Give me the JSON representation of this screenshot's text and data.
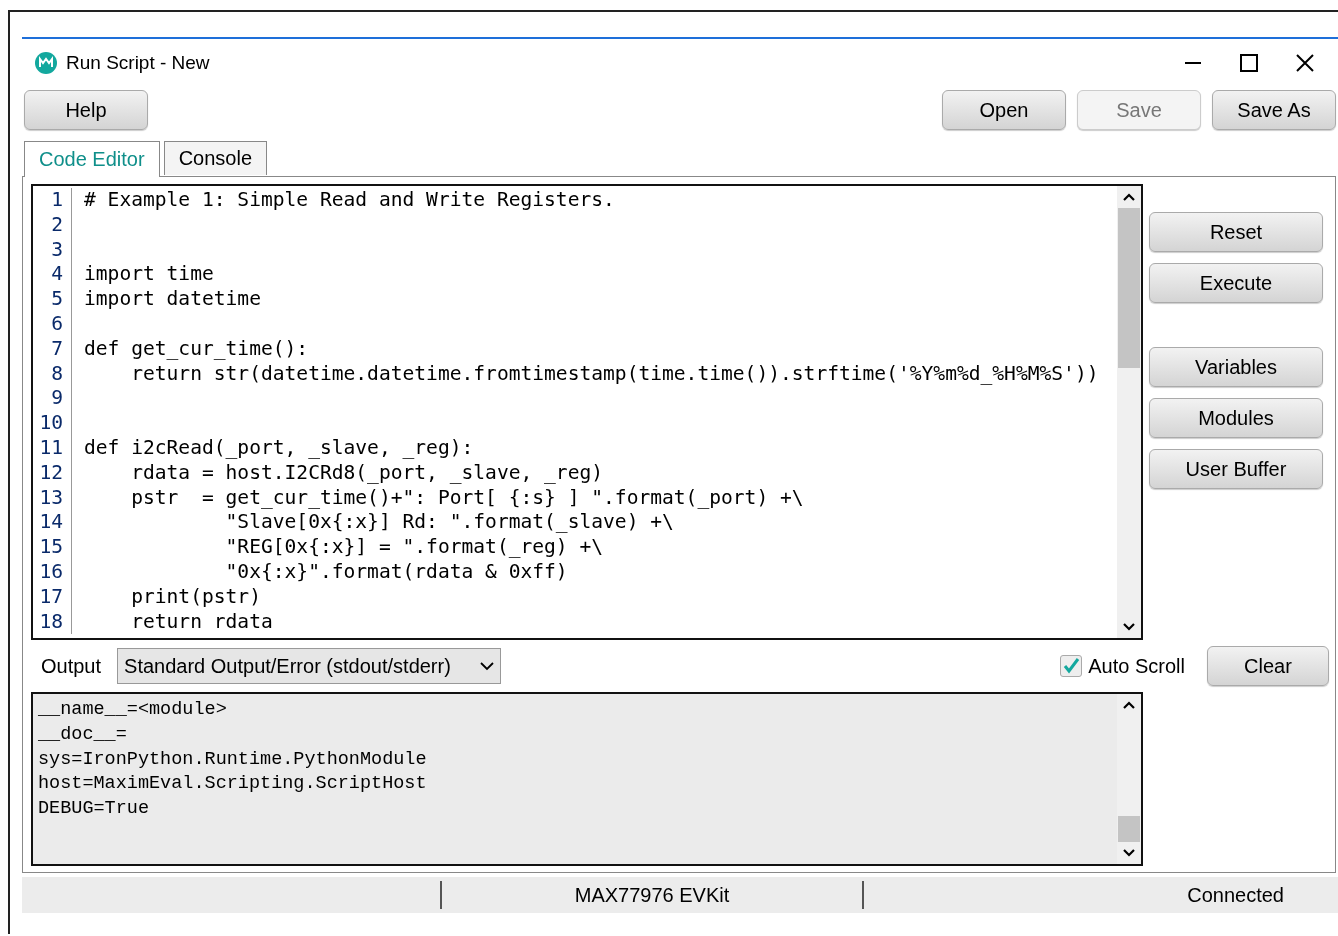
{
  "window": {
    "title": "Run Script - New"
  },
  "toolbar": {
    "left_buttons": [
      {
        "label": "Help",
        "disabled": false
      }
    ],
    "right_buttons": [
      {
        "label": "Open",
        "disabled": false
      },
      {
        "label": "Save",
        "disabled": true
      },
      {
        "label": "Save As",
        "disabled": false
      }
    ]
  },
  "tabs": [
    {
      "label": "Code Editor",
      "selected": true
    },
    {
      "label": "Console",
      "selected": false
    }
  ],
  "code_editor": {
    "lines": [
      {
        "number": "1",
        "text": "# Example 1: Simple Read and Write Registers."
      },
      {
        "number": "2"
      },
      {
        "number": "3"
      },
      {
        "number": "4",
        "text": "import time"
      },
      {
        "number": "5",
        "text": "import datetime"
      },
      {
        "number": "6"
      },
      {
        "number": "7",
        "text": "def get_cur_time():"
      },
      {
        "number": "8",
        "text": "    return str(datetime.datetime.fromtimestamp(time.time()).strftime('%Y%m%d_%H%M%S'))"
      },
      {
        "number": "9"
      },
      {
        "number": "10"
      },
      {
        "number": "11",
        "text": "def i2cRead(_port, _slave, _reg):"
      },
      {
        "number": "12",
        "text": "    rdata = host.I2CRd8(_port, _slave, _reg)"
      },
      {
        "number": "13",
        "text": "    pstr  = get_cur_time()+\": Port[ {:s} ] \".format(_port) +\\"
      },
      {
        "number": "14",
        "text": "            \"Slave[0x{:x}] Rd: \".format(_slave) +\\"
      },
      {
        "number": "15",
        "text": "            \"REG[0x{:x}] = \".format(_reg) +\\"
      },
      {
        "number": "16",
        "text": "            \"0x{:x}\".format(rdata & 0xff)"
      },
      {
        "number": "17",
        "text": "    print(pstr)"
      },
      {
        "number": "18",
        "text": "    return rdata"
      }
    ]
  },
  "side_button_groups": [
    [
      "Reset",
      "Execute"
    ],
    [
      "Variables",
      "Modules",
      "User Buffer"
    ]
  ],
  "output": {
    "label": "Output",
    "select_value": "Standard Output/Error (stdout/stderr)",
    "auto_scroll": {
      "label": "Auto Scroll",
      "checked": true
    },
    "clear_button": "Clear",
    "lines": [
      "__name__=<module>",
      "__doc__=",
      "sys=IronPython.Runtime.PythonModule",
      "host=MaximEval.Scripting.ScriptHost",
      "DEBUG=True"
    ]
  },
  "status_bar": {
    "device": "MAX77976 EVKit",
    "connection": "Connected"
  }
}
